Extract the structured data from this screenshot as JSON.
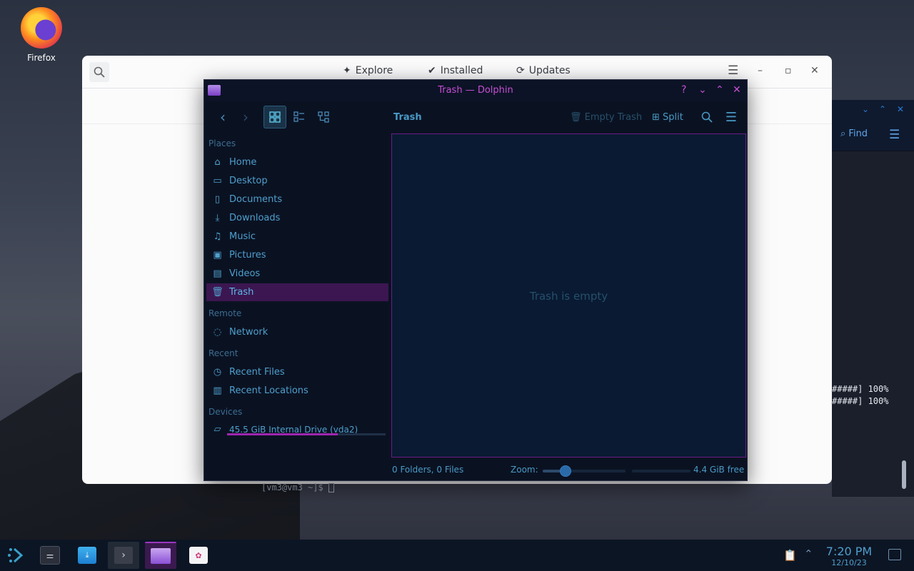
{
  "desktop": {
    "icons": [
      {
        "label": "Firefox",
        "icon": "firefox-icon"
      }
    ]
  },
  "discover": {
    "tabs": [
      {
        "label": "Explore",
        "icon": "sparkle-icon"
      },
      {
        "label": "Installed",
        "icon": "check-circle-icon"
      },
      {
        "label": "Updates",
        "icon": "refresh-icon"
      }
    ]
  },
  "terminal": {
    "find_label": "Find",
    "lines": [
      "#####] 100%",
      "#####] 100%"
    ],
    "prompt": "[vm3@vm3 ~]$ "
  },
  "dolphin": {
    "title": "Trash — Dolphin",
    "breadcrumb": "Trash",
    "toolbar": {
      "empty_trash": "Empty Trash",
      "split": "Split"
    },
    "sidebar": {
      "places_header": "Places",
      "places": [
        {
          "label": "Home",
          "icon": "home-icon"
        },
        {
          "label": "Desktop",
          "icon": "desktop-icon"
        },
        {
          "label": "Documents",
          "icon": "documents-icon"
        },
        {
          "label": "Downloads",
          "icon": "downloads-icon"
        },
        {
          "label": "Music",
          "icon": "music-icon"
        },
        {
          "label": "Pictures",
          "icon": "pictures-icon"
        },
        {
          "label": "Videos",
          "icon": "videos-icon"
        },
        {
          "label": "Trash",
          "icon": "trash-icon"
        }
      ],
      "remote_header": "Remote",
      "remote": [
        {
          "label": "Network",
          "icon": "network-icon"
        }
      ],
      "recent_header": "Recent",
      "recent": [
        {
          "label": "Recent Files",
          "icon": "recent-files-icon"
        },
        {
          "label": "Recent Locations",
          "icon": "recent-locations-icon"
        }
      ],
      "devices_header": "Devices",
      "devices": [
        {
          "label": "45.5 GiB Internal Drive (vda2)",
          "icon": "drive-icon",
          "usage_fraction": 0.7
        }
      ]
    },
    "content": {
      "empty_message": "Trash is empty"
    },
    "status": {
      "summary": "0 Folders, 0 Files",
      "zoom_label": "Zoom:",
      "zoom_fraction": 0.28,
      "free_space": "4.4 GiB free"
    }
  },
  "taskbar": {
    "time": "7:20 PM",
    "date": "12/10/23"
  },
  "colors": {
    "accent_magenta": "#c64ed4",
    "accent_cyan": "#4f9fcc",
    "selection": "#3c1651"
  }
}
